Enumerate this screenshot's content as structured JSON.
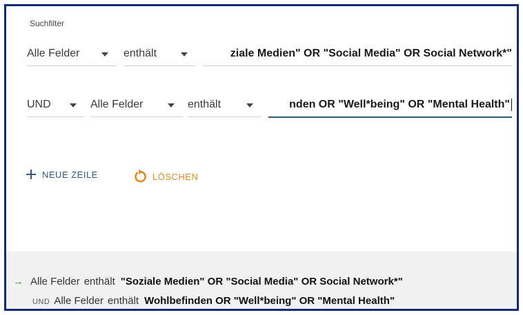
{
  "panel": {
    "title": "Suchfilter"
  },
  "row1": {
    "field": "Alle Felder",
    "condition": "enthält",
    "query": "ziale Medien\" OR \"Social Media\" OR Social Network*\""
  },
  "row2": {
    "operator": "UND",
    "field": "Alle Felder",
    "condition": "enthält",
    "query": "nden OR \"Well*being\" OR \"Mental Health\""
  },
  "actions": {
    "add_row": "NEUE ZEILE",
    "clear": "LÖSCHEN"
  },
  "colors": {
    "accent": "#315a78",
    "clear": "#e08a1e",
    "arrow": "#2e9a3a",
    "frame": "#0e2a78"
  },
  "summary": {
    "line1": {
      "arrow": "→",
      "field": "Alle Felder",
      "condition": "enthält",
      "query": "\"Soziale Medien\" OR \"Social Media\" OR Social Network*\""
    },
    "line2": {
      "operator": "UND",
      "field": "Alle Felder",
      "condition": "enthält",
      "query": "Wohlbefinden OR \"Well*being\" OR \"Mental Health\""
    }
  }
}
